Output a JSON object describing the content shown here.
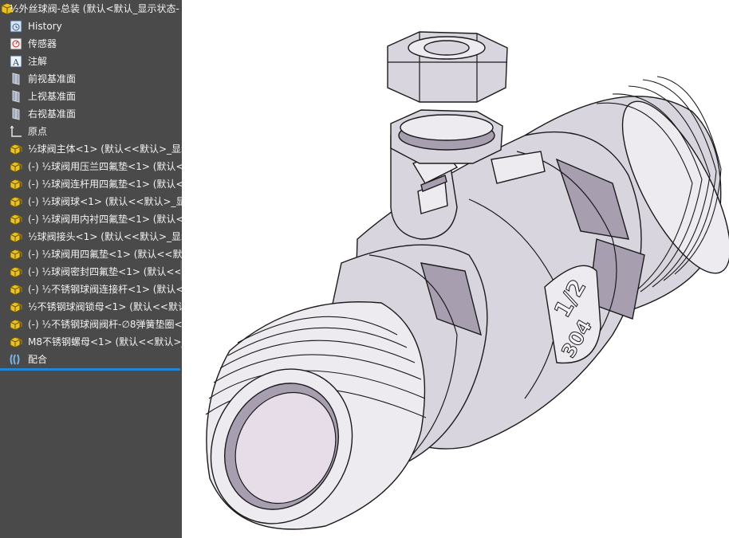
{
  "feature_tree": {
    "root": "½外丝球阀-总装  (默认<默认_显示状态-",
    "items": [
      {
        "label": "History",
        "icon": "history-icon"
      },
      {
        "label": "传感器",
        "icon": "sensor-icon"
      },
      {
        "label": "注解",
        "icon": "annotation-icon"
      },
      {
        "label": "前视基准面",
        "icon": "plane-icon"
      },
      {
        "label": "上视基准面",
        "icon": "plane-icon"
      },
      {
        "label": "右视基准面",
        "icon": "plane-icon"
      },
      {
        "label": "原点",
        "icon": "origin-icon"
      },
      {
        "label": "½球阀主体<1> (默认<<默认>_显示",
        "icon": "part-icon"
      },
      {
        "label": "(-) ½球阀用压兰四氟垫<1> (默认<",
        "icon": "part-icon"
      },
      {
        "label": "(-) ½球阀连杆用四氟垫<1> (默认<",
        "icon": "part-icon"
      },
      {
        "label": "(-) ½球阀球<1> (默认<<默认>_显",
        "icon": "part-icon"
      },
      {
        "label": "(-) ½球阀用内衬四氟垫<1> (默认<",
        "icon": "part-icon"
      },
      {
        "label": "½球阀接头<1> (默认<<默认>_显示",
        "icon": "part-icon"
      },
      {
        "label": "(-) ½球阀用四氟垫<1> (默认<<默认",
        "icon": "part-icon"
      },
      {
        "label": "(-) ½球阀密封四氟垫<1> (默认<<默",
        "icon": "part-icon"
      },
      {
        "label": "(-) ½不锈钢球阀连接杆<1> (默认<",
        "icon": "part-icon"
      },
      {
        "label": "½不锈钢球阀锁母<1> (默认<<默认",
        "icon": "part-icon"
      },
      {
        "label": "(-) ½不锈钢球阀阀杆-∅8弹簧垫圈<",
        "icon": "part-icon"
      },
      {
        "label": "M8不锈钢螺母<1> (默认<<默认>_",
        "icon": "part-icon"
      },
      {
        "label": "配合",
        "icon": "mates-icon"
      }
    ]
  },
  "model": {
    "marking_size": "1/2",
    "marking_material": "304"
  },
  "colors": {
    "panel_bg": "#4a4a4a",
    "selection_accent": "#1e88d6",
    "model_body": "#d9d5de",
    "model_shadow": "#a79fb0"
  }
}
